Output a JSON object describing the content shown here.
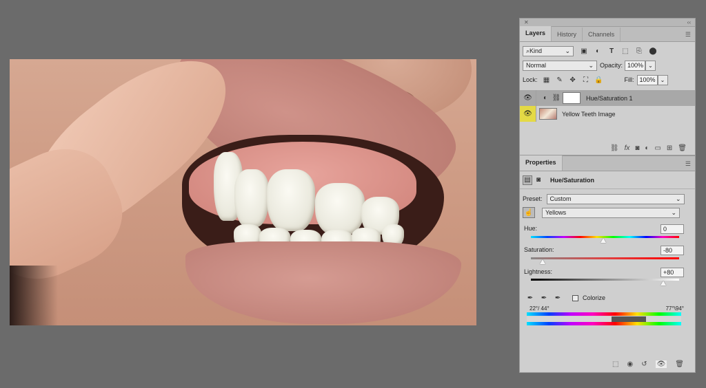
{
  "layers_panel": {
    "tabs": [
      "Layers",
      "History",
      "Channels"
    ],
    "filter_kind": "Kind",
    "blend_mode": "Normal",
    "opacity_label": "Opacity:",
    "opacity_value": "100%",
    "lock_label": "Lock:",
    "fill_label": "Fill:",
    "fill_value": "100%",
    "layers": [
      {
        "name": "Hue/Saturation 1"
      },
      {
        "name": "Yellow Teeth Image"
      }
    ]
  },
  "properties_panel": {
    "tab": "Properties",
    "adjustment_title": "Hue/Saturation",
    "preset_label": "Preset:",
    "preset_value": "Custom",
    "channel_value": "Yellows",
    "hue_label": "Hue:",
    "hue_value": "0",
    "saturation_label": "Saturation:",
    "saturation_value": "-80",
    "lightness_label": "Lightness:",
    "lightness_value": "+80",
    "colorize_label": "Colorize",
    "range_left": "22°/ 44°",
    "range_right": "77°\\94°"
  }
}
